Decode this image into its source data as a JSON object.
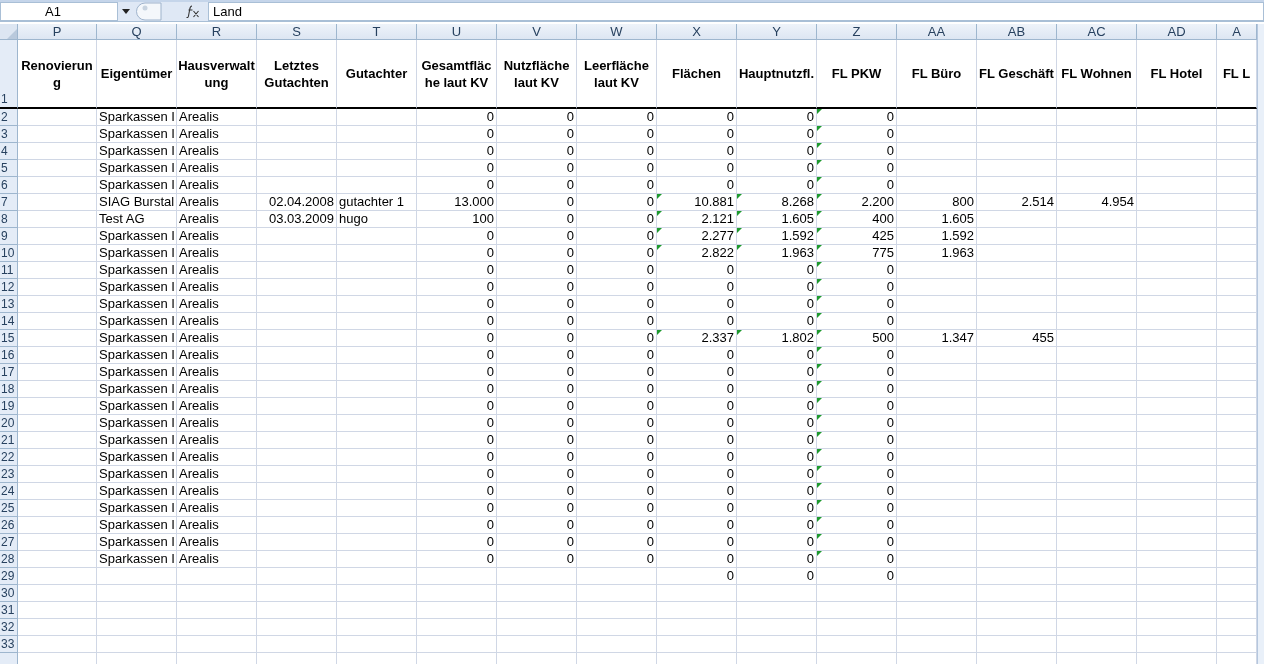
{
  "formula_bar": {
    "name_box": "A1",
    "formula": "Land"
  },
  "columns": [
    {
      "letter": "P",
      "header": "Renovierung",
      "kind": "text"
    },
    {
      "letter": "Q",
      "header": "Eigentümer",
      "kind": "text"
    },
    {
      "letter": "R",
      "header": "Hausverwaltung",
      "kind": "text"
    },
    {
      "letter": "S",
      "header": "Letztes Gutachten",
      "kind": "number"
    },
    {
      "letter": "T",
      "header": "Gutachter",
      "kind": "text"
    },
    {
      "letter": "U",
      "header": "Gesamtfläche laut KV",
      "kind": "number"
    },
    {
      "letter": "V",
      "header": "Nutzfläche laut KV",
      "kind": "number"
    },
    {
      "letter": "W",
      "header": "Leerfläche laut KV",
      "kind": "number"
    },
    {
      "letter": "X",
      "header": "Flächen",
      "kind": "number"
    },
    {
      "letter": "Y",
      "header": "Hauptnutzfl.",
      "kind": "number"
    },
    {
      "letter": "Z",
      "header": "FL PKW",
      "kind": "number"
    },
    {
      "letter": "AA",
      "header": "FL Büro",
      "kind": "number"
    },
    {
      "letter": "AB",
      "header": "FL Geschäft",
      "kind": "number"
    },
    {
      "letter": "AC",
      "header": "FL Wohnen",
      "kind": "number"
    },
    {
      "letter": "AD",
      "header": "FL Hotel",
      "kind": "number"
    },
    {
      "letter": "A",
      "header": "FL L",
      "kind": "number"
    }
  ],
  "header_row_number": "1",
  "rows": [
    {
      "number": "2",
      "cells": [
        null,
        "Sparkassen I",
        "Arealis",
        null,
        null,
        "0",
        "0",
        "0",
        "0",
        "0",
        {
          "text": "0",
          "flagged": true
        }
      ]
    },
    {
      "number": "3",
      "cells": [
        null,
        "Sparkassen I",
        "Arealis",
        null,
        null,
        "0",
        "0",
        "0",
        "0",
        "0",
        {
          "text": "0",
          "flagged": true
        }
      ]
    },
    {
      "number": "4",
      "cells": [
        null,
        "Sparkassen I",
        "Arealis",
        null,
        null,
        "0",
        "0",
        "0",
        "0",
        "0",
        {
          "text": "0",
          "flagged": true
        }
      ]
    },
    {
      "number": "5",
      "cells": [
        null,
        "Sparkassen I",
        "Arealis",
        null,
        null,
        "0",
        "0",
        "0",
        "0",
        "0",
        {
          "text": "0",
          "flagged": true
        }
      ]
    },
    {
      "number": "6",
      "cells": [
        null,
        "Sparkassen I",
        "Arealis",
        null,
        null,
        "0",
        "0",
        "0",
        "0",
        "0",
        {
          "text": "0",
          "flagged": true
        }
      ]
    },
    {
      "number": "7",
      "cells": [
        null,
        "SIAG Burstal",
        "Arealis",
        "02.04.2008",
        "gutachter 1",
        "13.000",
        "0",
        "0",
        {
          "text": "10.881",
          "flagged": true
        },
        {
          "text": "8.268",
          "flagged": true
        },
        {
          "text": "2.200",
          "flagged": true
        },
        "800",
        "2.514",
        "4.954"
      ]
    },
    {
      "number": "8",
      "cells": [
        null,
        "Test AG",
        "Arealis",
        "03.03.2009",
        "hugo",
        "100",
        "0",
        "0",
        {
          "text": "2.121",
          "flagged": true
        },
        {
          "text": "1.605",
          "flagged": true
        },
        {
          "text": "400",
          "flagged": true
        },
        "1.605"
      ]
    },
    {
      "number": "9",
      "cells": [
        null,
        "Sparkassen I",
        "Arealis",
        null,
        null,
        "0",
        "0",
        "0",
        {
          "text": "2.277",
          "flagged": true
        },
        {
          "text": "1.592",
          "flagged": true
        },
        {
          "text": "425",
          "flagged": true
        },
        "1.592"
      ]
    },
    {
      "number": "10",
      "cells": [
        null,
        "Sparkassen I",
        "Arealis",
        null,
        null,
        "0",
        "0",
        "0",
        {
          "text": "2.822",
          "flagged": true
        },
        {
          "text": "1.963",
          "flagged": true
        },
        {
          "text": "775",
          "flagged": true
        },
        "1.963"
      ]
    },
    {
      "number": "11",
      "cells": [
        null,
        "Sparkassen I",
        "Arealis",
        null,
        null,
        "0",
        "0",
        "0",
        "0",
        "0",
        {
          "text": "0",
          "flagged": true
        }
      ]
    },
    {
      "number": "12",
      "cells": [
        null,
        "Sparkassen I",
        "Arealis",
        null,
        null,
        "0",
        "0",
        "0",
        "0",
        "0",
        {
          "text": "0",
          "flagged": true
        }
      ]
    },
    {
      "number": "13",
      "cells": [
        null,
        "Sparkassen I",
        "Arealis",
        null,
        null,
        "0",
        "0",
        "0",
        "0",
        "0",
        {
          "text": "0",
          "flagged": true
        }
      ]
    },
    {
      "number": "14",
      "cells": [
        null,
        "Sparkassen I",
        "Arealis",
        null,
        null,
        "0",
        "0",
        "0",
        "0",
        "0",
        {
          "text": "0",
          "flagged": true
        }
      ]
    },
    {
      "number": "15",
      "cells": [
        null,
        "Sparkassen I",
        "Arealis",
        null,
        null,
        "0",
        "0",
        "0",
        {
          "text": "2.337",
          "flagged": true
        },
        {
          "text": "1.802",
          "flagged": true
        },
        {
          "text": "500",
          "flagged": true
        },
        "1.347",
        "455"
      ]
    },
    {
      "number": "16",
      "cells": [
        null,
        "Sparkassen I",
        "Arealis",
        null,
        null,
        "0",
        "0",
        "0",
        "0",
        "0",
        {
          "text": "0",
          "flagged": true
        }
      ]
    },
    {
      "number": "17",
      "cells": [
        null,
        "Sparkassen I",
        "Arealis",
        null,
        null,
        "0",
        "0",
        "0",
        "0",
        "0",
        {
          "text": "0",
          "flagged": true
        }
      ]
    },
    {
      "number": "18",
      "cells": [
        null,
        "Sparkassen I",
        "Arealis",
        null,
        null,
        "0",
        "0",
        "0",
        "0",
        "0",
        {
          "text": "0",
          "flagged": true
        }
      ]
    },
    {
      "number": "19",
      "cells": [
        null,
        "Sparkassen I",
        "Arealis",
        null,
        null,
        "0",
        "0",
        "0",
        "0",
        "0",
        {
          "text": "0",
          "flagged": true
        }
      ]
    },
    {
      "number": "20",
      "cells": [
        null,
        "Sparkassen I",
        "Arealis",
        null,
        null,
        "0",
        "0",
        "0",
        "0",
        "0",
        {
          "text": "0",
          "flagged": true
        }
      ]
    },
    {
      "number": "21",
      "cells": [
        null,
        "Sparkassen I",
        "Arealis",
        null,
        null,
        "0",
        "0",
        "0",
        "0",
        "0",
        {
          "text": "0",
          "flagged": true
        }
      ]
    },
    {
      "number": "22",
      "cells": [
        null,
        "Sparkassen I",
        "Arealis",
        null,
        null,
        "0",
        "0",
        "0",
        "0",
        "0",
        {
          "text": "0",
          "flagged": true
        }
      ]
    },
    {
      "number": "23",
      "cells": [
        null,
        "Sparkassen I",
        "Arealis",
        null,
        null,
        "0",
        "0",
        "0",
        "0",
        "0",
        {
          "text": "0",
          "flagged": true
        }
      ]
    },
    {
      "number": "24",
      "cells": [
        null,
        "Sparkassen I",
        "Arealis",
        null,
        null,
        "0",
        "0",
        "0",
        "0",
        "0",
        {
          "text": "0",
          "flagged": true
        }
      ]
    },
    {
      "number": "25",
      "cells": [
        null,
        "Sparkassen I",
        "Arealis",
        null,
        null,
        "0",
        "0",
        "0",
        "0",
        "0",
        {
          "text": "0",
          "flagged": true
        }
      ]
    },
    {
      "number": "26",
      "cells": [
        null,
        "Sparkassen I",
        "Arealis",
        null,
        null,
        "0",
        "0",
        "0",
        "0",
        "0",
        {
          "text": "0",
          "flagged": true
        }
      ]
    },
    {
      "number": "27",
      "cells": [
        null,
        "Sparkassen I",
        "Arealis",
        null,
        null,
        "0",
        "0",
        "0",
        "0",
        "0",
        {
          "text": "0",
          "flagged": true
        }
      ]
    },
    {
      "number": "28",
      "cells": [
        null,
        "Sparkassen I",
        "Arealis",
        null,
        null,
        "0",
        "0",
        "0",
        "0",
        "0",
        {
          "text": "0",
          "flagged": true
        }
      ]
    },
    {
      "number": "29",
      "cells": [
        null,
        null,
        null,
        null,
        null,
        null,
        null,
        null,
        "0",
        "0",
        {
          "text": "0",
          "flagged": false
        }
      ]
    },
    {
      "number": "30"
    },
    {
      "number": "31"
    },
    {
      "number": "32"
    },
    {
      "number": "33"
    }
  ]
}
